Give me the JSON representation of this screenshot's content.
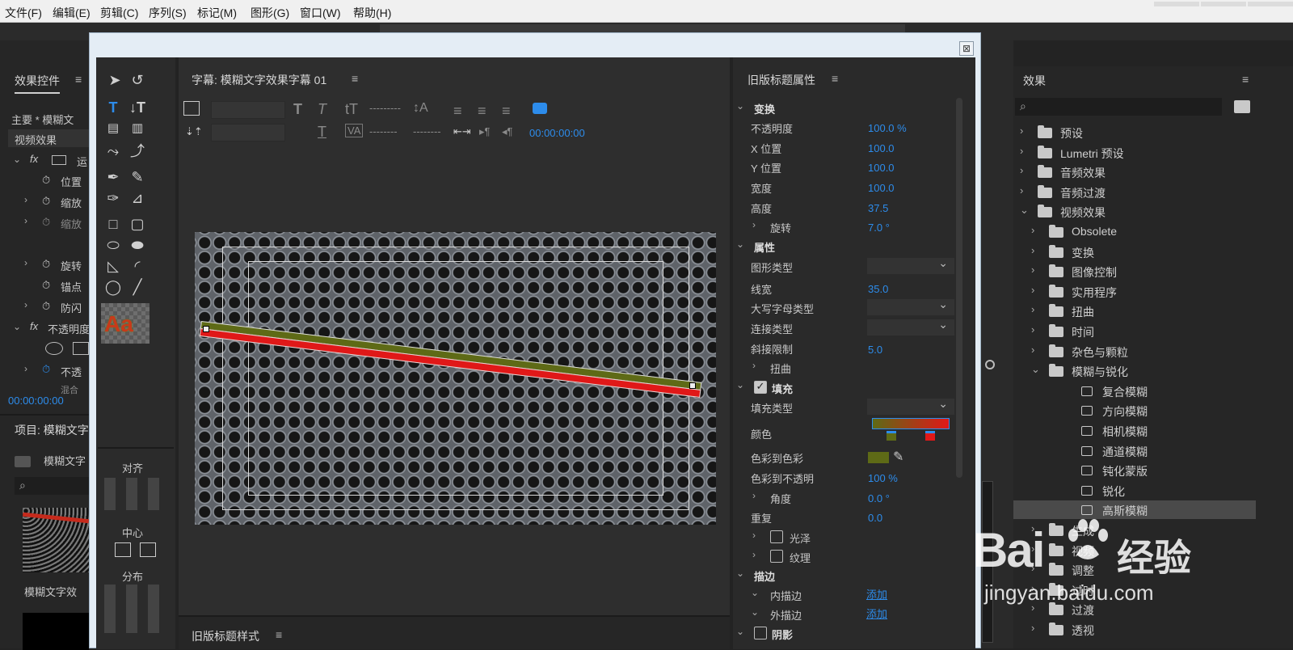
{
  "menu": [
    "文件(F)",
    "编辑(E)",
    "剪辑(C)",
    "序列(S)",
    "标记(M)",
    "图形(G)",
    "窗口(W)",
    "帮助(H)"
  ],
  "left_panel": {
    "title": "效果控件",
    "master": "主要 * 模糊文",
    "section": "视频效果",
    "rows": [
      "运",
      "位置",
      "缩放",
      "缩放",
      "旋转",
      "锚点",
      "防闪",
      "不透明度",
      "不透",
      "混合"
    ],
    "timecode": "00:00:00:00"
  },
  "project_panel": {
    "title": "项目: 模糊文字",
    "bin_label": "模糊文字",
    "clip_label": "模糊文字效"
  },
  "title_window": {
    "close": "⊠",
    "title_header": "字幕: 模糊文字效果字幕 01",
    "timecode": "00:00:00:00",
    "text_placeholders": [
      "---------",
      "--------",
      "--------"
    ],
    "align_label": "对齐",
    "center_label": "中心",
    "distribute_label": "分布",
    "style_label": "Aa",
    "styles_header": "旧版标题样式"
  },
  "properties": {
    "header": "旧版标题属性",
    "transform": "变换",
    "opacity_label": "不透明度",
    "opacity": "100.0 %",
    "x_label": "X 位置",
    "x": "100.0",
    "y_label": "Y 位置",
    "y": "100.0",
    "width_label": "宽度",
    "width": "100.0",
    "height_label": "高度",
    "height": "37.5",
    "rotation_label": "旋转",
    "rotation": "7.0 °",
    "attributes": "属性",
    "graphic_type": "图形类型",
    "line_width_label": "线宽",
    "line_width": "35.0",
    "caps_type": "大写字母类型",
    "join_type": "连接类型",
    "miter_label": "斜接限制",
    "miter": "5.0",
    "distort": "扭曲",
    "fill": "填充",
    "fill_type": "填充类型",
    "color": "颜色",
    "color_to_color": "色彩到色彩",
    "color_to_opacity_label": "色彩到不透明",
    "color_to_opacity": "100 %",
    "angle_label": "角度",
    "angle": "0.0 °",
    "repeat_label": "重复",
    "repeat": "0.0",
    "sheen": "光泽",
    "texture": "纹理",
    "strokes": "描边",
    "inner_stroke": "内描边",
    "inner_add": "添加",
    "outer_stroke": "外描边",
    "outer_add": "添加",
    "shadow": "阴影",
    "gradient_left": "#5e6a16",
    "gradient_right": "#e01818"
  },
  "effects_panel": {
    "title": "效果",
    "items": [
      {
        "label": "预设",
        "level": 0,
        "kind": "preset"
      },
      {
        "label": "Lumetri 预设",
        "level": 0,
        "kind": "preset"
      },
      {
        "label": "音频效果",
        "level": 0,
        "kind": "folder"
      },
      {
        "label": "音频过渡",
        "level": 0,
        "kind": "folder"
      },
      {
        "label": "视频效果",
        "level": 0,
        "kind": "folder",
        "open": true
      },
      {
        "label": "Obsolete",
        "level": 1,
        "kind": "folder"
      },
      {
        "label": "变换",
        "level": 1,
        "kind": "folder"
      },
      {
        "label": "图像控制",
        "level": 1,
        "kind": "folder"
      },
      {
        "label": "实用程序",
        "level": 1,
        "kind": "folder"
      },
      {
        "label": "扭曲",
        "level": 1,
        "kind": "folder"
      },
      {
        "label": "时间",
        "level": 1,
        "kind": "folder"
      },
      {
        "label": "杂色与颗粒",
        "level": 1,
        "kind": "folder"
      },
      {
        "label": "模糊与锐化",
        "level": 1,
        "kind": "folder",
        "open": true
      },
      {
        "label": "复合模糊",
        "level": 2,
        "kind": "fx"
      },
      {
        "label": "方向模糊",
        "level": 2,
        "kind": "fx"
      },
      {
        "label": "相机模糊",
        "level": 2,
        "kind": "fx"
      },
      {
        "label": "通道模糊",
        "level": 2,
        "kind": "fx"
      },
      {
        "label": "钝化蒙版",
        "level": 2,
        "kind": "fx"
      },
      {
        "label": "锐化",
        "level": 2,
        "kind": "fx"
      },
      {
        "label": "高斯模糊",
        "level": 2,
        "kind": "fx",
        "selected": true
      },
      {
        "label": "生成",
        "level": 1,
        "kind": "folder"
      },
      {
        "label": "视频",
        "level": 1,
        "kind": "folder"
      },
      {
        "label": "调整",
        "level": 1,
        "kind": "folder"
      },
      {
        "label": "过时",
        "level": 1,
        "kind": "folder"
      },
      {
        "label": "过渡",
        "level": 1,
        "kind": "folder"
      },
      {
        "label": "透视",
        "level": 1,
        "kind": "folder"
      }
    ]
  },
  "watermark": {
    "brand": "Bai",
    "brand2": "经验",
    "url": "jingyan.baidu.com"
  }
}
